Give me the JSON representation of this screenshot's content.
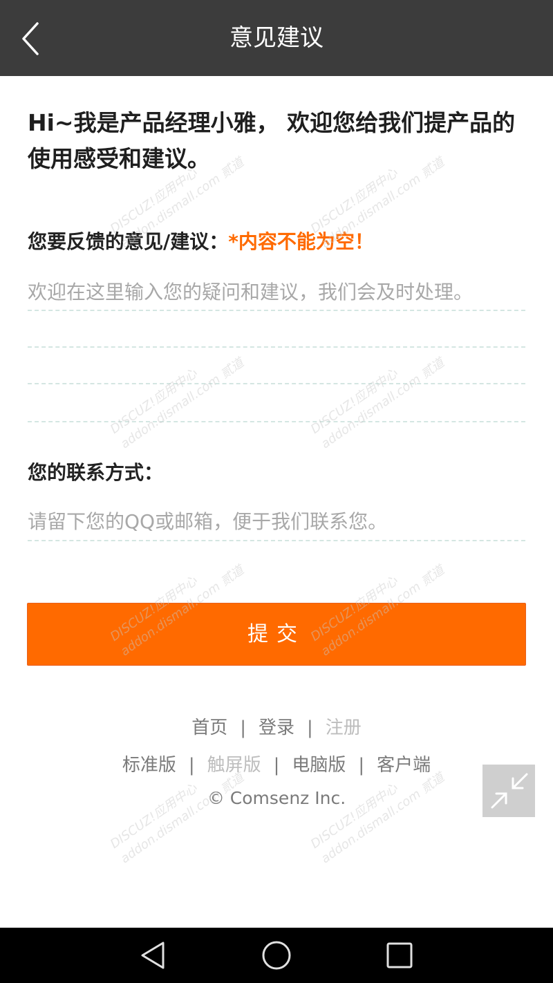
{
  "header": {
    "title": "意见建议"
  },
  "intro": {
    "text": "Hi~我是产品经理小雅， 欢迎您给我们提产品的使用感受和建议。"
  },
  "feedback": {
    "label": "您要反馈的意见/建议：",
    "error": "*内容不能为空！",
    "placeholder": "欢迎在这里输入您的疑问和建议，我们会及时处理。"
  },
  "contact": {
    "label": "您的联系方式：",
    "placeholder": "请留下您的QQ或邮箱，便于我们联系您。"
  },
  "submit": {
    "label": "提交"
  },
  "footer": {
    "links1": [
      "首页",
      "登录",
      "注册"
    ],
    "links2": [
      "标准版",
      "触屏版",
      "电脑版",
      "客户端"
    ],
    "separator": "|",
    "copyright": "© Comsenz Inc."
  },
  "watermark": {
    "text": "DISCUZ!应用中心 addon.dismall.com 贰道"
  },
  "colors": {
    "accent": "#ff6a00",
    "topbar": "#3c3c3c",
    "navbar": "#000000"
  }
}
